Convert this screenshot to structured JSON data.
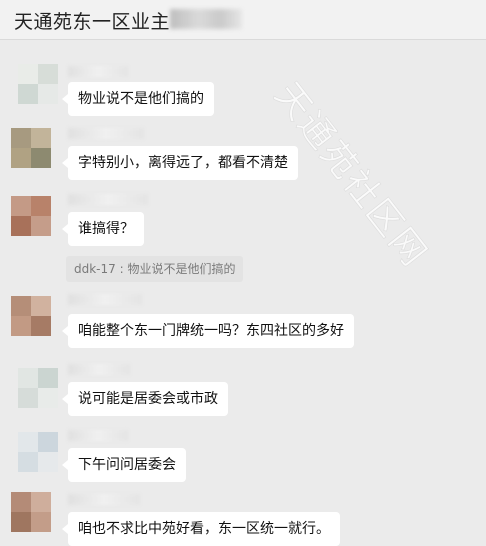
{
  "header": {
    "title": "天通苑东一区业主"
  },
  "watermark": "天通苑社区网",
  "messages": [
    {
      "text": "物业说不是他们搞的"
    },
    {
      "text": "字特别小，离得远了，都看不清楚"
    },
    {
      "text": "谁搞得？"
    },
    {
      "quote": "ddk-17 : 物业说不是他们搞的"
    },
    {
      "text": "咱能整个东一门牌统一吗？东四社区的多好"
    },
    {
      "text": "说可能是居委会或市政"
    },
    {
      "text": "下午问问居委会"
    },
    {
      "text": "咱也不求比中苑好看，东一区统一就行。"
    }
  ],
  "colors": {
    "background": "#ebebeb",
    "header": "#f2f2f2",
    "bubble": "#ffffff",
    "quote": "#e3e3e3"
  }
}
